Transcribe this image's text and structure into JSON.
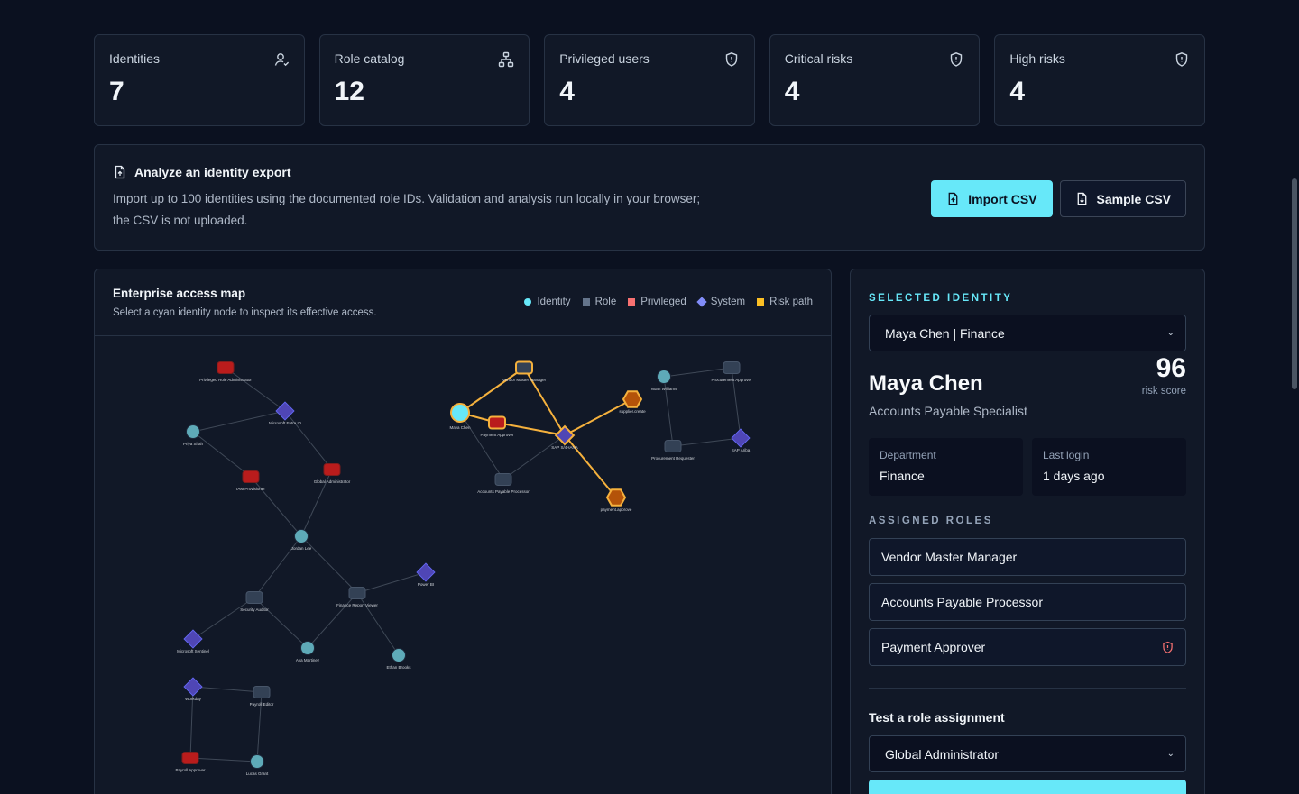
{
  "stats": [
    {
      "label": "Identities",
      "value": "7",
      "icon": "user-icon"
    },
    {
      "label": "Role catalog",
      "value": "12",
      "icon": "hierarchy-icon"
    },
    {
      "label": "Privileged users",
      "value": "4",
      "icon": "shield-icon"
    },
    {
      "label": "Critical risks",
      "value": "4",
      "icon": "shield-icon"
    },
    {
      "label": "High risks",
      "value": "4",
      "icon": "shield-icon"
    }
  ],
  "import": {
    "title": "Analyze an identity export",
    "description": "Import up to 100 identities using the documented role IDs. Validation and analysis run locally in your browser; the CSV is not uploaded.",
    "import_label": "Import CSV",
    "sample_label": "Sample CSV"
  },
  "map": {
    "title": "Enterprise access map",
    "subtitle": "Select a cyan identity node to inspect its effective access.",
    "legend": [
      {
        "label": "Identity",
        "color": "#67e8f9",
        "shape": "circle"
      },
      {
        "label": "Role",
        "color": "#64748b",
        "shape": "square"
      },
      {
        "label": "Privileged",
        "color": "#f87171",
        "shape": "square"
      },
      {
        "label": "System",
        "color": "#818cf8",
        "shape": "diamond"
      },
      {
        "label": "Risk path",
        "color": "#fbbf24",
        "shape": "square"
      }
    ],
    "nodes": [
      {
        "id": "pra",
        "label": "Privileged Role Administrator",
        "type": "privileged"
      },
      {
        "id": "entra",
        "label": "Microsoft Entra ID",
        "type": "system"
      },
      {
        "id": "priya",
        "label": "Priya Shah",
        "type": "identity"
      },
      {
        "id": "iam",
        "label": "IAM Provisioner",
        "type": "privileged"
      },
      {
        "id": "gadmin",
        "label": "Global Administrator",
        "type": "privileged"
      },
      {
        "id": "jordan",
        "label": "Jordan Lee",
        "type": "identity"
      },
      {
        "id": "secaud",
        "label": "Security Auditor",
        "type": "role"
      },
      {
        "id": "frv",
        "label": "Finance Report Viewer",
        "type": "role"
      },
      {
        "id": "pbi",
        "label": "Power BI",
        "type": "system"
      },
      {
        "id": "sentinel",
        "label": "Microsoft Sentinel",
        "type": "system"
      },
      {
        "id": "ava",
        "label": "Ava Martinez",
        "type": "identity"
      },
      {
        "id": "ethan",
        "label": "Ethan Brooks",
        "type": "identity"
      },
      {
        "id": "workday",
        "label": "Workday",
        "type": "system"
      },
      {
        "id": "payedit",
        "label": "Payroll Editor",
        "type": "role"
      },
      {
        "id": "payappr",
        "label": "Payroll Approver",
        "type": "privileged"
      },
      {
        "id": "lucas",
        "label": "Lucas Grant",
        "type": "identity"
      },
      {
        "id": "maya",
        "label": "Maya Chen",
        "type": "identity"
      },
      {
        "id": "vmm",
        "label": "Vendor Master Manager",
        "type": "role"
      },
      {
        "id": "payap",
        "label": "Payment Approver",
        "type": "privileged"
      },
      {
        "id": "s4",
        "label": "SAP S/4HANA",
        "type": "system"
      },
      {
        "id": "apProc",
        "label": "Accounts Payable Processor",
        "type": "role"
      },
      {
        "id": "supcreate",
        "label": "supplier.create",
        "type": "risk"
      },
      {
        "id": "payapprove",
        "label": "payment.approve",
        "type": "risk"
      },
      {
        "id": "noah",
        "label": "Noah Williams",
        "type": "identity"
      },
      {
        "id": "procappr",
        "label": "Procurement Approver",
        "type": "role"
      },
      {
        "id": "procreq",
        "label": "Procurement Requester",
        "type": "role"
      },
      {
        "id": "ariba",
        "label": "SAP Ariba",
        "type": "system"
      }
    ],
    "edges": [
      [
        "pra",
        "entra",
        false
      ],
      [
        "priya",
        "entra",
        false
      ],
      [
        "priya",
        "iam",
        false
      ],
      [
        "entra",
        "gadmin",
        false
      ],
      [
        "iam",
        "jordan",
        false
      ],
      [
        "gadmin",
        "jordan",
        false
      ],
      [
        "jordan",
        "secaud",
        false
      ],
      [
        "jordan",
        "frv",
        false
      ],
      [
        "frv",
        "pbi",
        false
      ],
      [
        "secaud",
        "sentinel",
        false
      ],
      [
        "secaud",
        "ava",
        false
      ],
      [
        "frv",
        "ava",
        false
      ],
      [
        "frv",
        "ethan",
        false
      ],
      [
        "workday",
        "payedit",
        false
      ],
      [
        "workday",
        "payappr",
        false
      ],
      [
        "payedit",
        "lucas",
        false
      ],
      [
        "payappr",
        "lucas",
        false
      ],
      [
        "maya",
        "vmm",
        true
      ],
      [
        "maya",
        "payap",
        true
      ],
      [
        "vmm",
        "s4",
        true
      ],
      [
        "payap",
        "s4",
        true
      ],
      [
        "s4",
        "supcreate",
        true
      ],
      [
        "s4",
        "payapprove",
        true
      ],
      [
        "maya",
        "apProc",
        false
      ],
      [
        "apProc",
        "s4",
        false
      ],
      [
        "noah",
        "procappr",
        false
      ],
      [
        "noah",
        "procreq",
        false
      ],
      [
        "procappr",
        "ariba",
        false
      ],
      [
        "procreq",
        "ariba",
        false
      ]
    ]
  },
  "side": {
    "eyebrow": "SELECTED IDENTITY",
    "selected": "Maya Chen | Finance",
    "name": "Maya Chen",
    "title": "Accounts Payable Specialist",
    "score": "96",
    "score_caption": "risk score",
    "department_label": "Department",
    "department": "Finance",
    "login_label": "Last login",
    "login": "1 days ago",
    "roles_heading": "ASSIGNED ROLES",
    "roles": [
      {
        "label": "Vendor Master Manager",
        "privileged": false
      },
      {
        "label": "Accounts Payable Processor",
        "privileged": false
      },
      {
        "label": "Payment Approver",
        "privileged": true
      }
    ],
    "test_label": "Test a role assignment",
    "test_role": "Global Administrator"
  },
  "colors": {
    "identity": "#5eaab8",
    "identity_selected": "#67e8f9",
    "role": "#334155",
    "privileged": "#b91c1c",
    "system": "#4f46b5",
    "risk": "#f5b13d",
    "edge": "#4b5563"
  }
}
